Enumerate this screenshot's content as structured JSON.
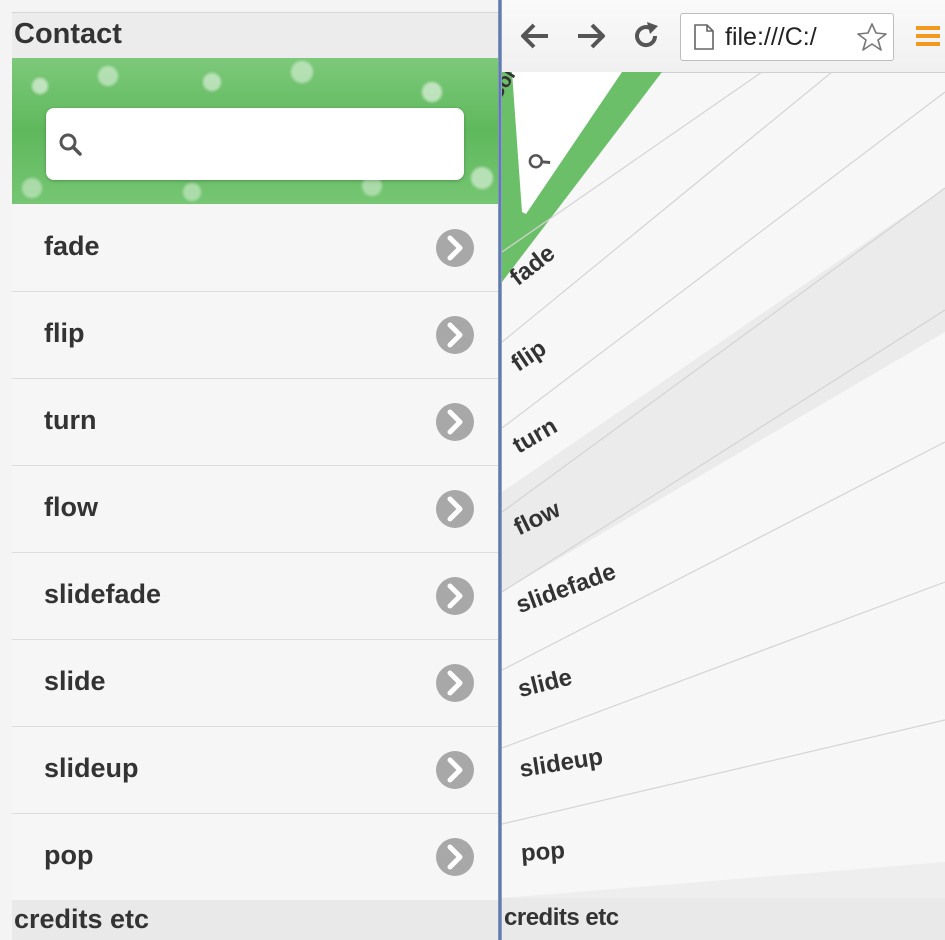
{
  "left": {
    "header_title": "Contact",
    "search": {
      "value": "",
      "placeholder": ""
    },
    "items": [
      {
        "label": "fade"
      },
      {
        "label": "flip"
      },
      {
        "label": "turn"
      },
      {
        "label": "flow"
      },
      {
        "label": "slidefade"
      },
      {
        "label": "slide"
      },
      {
        "label": "slideup"
      },
      {
        "label": "pop"
      }
    ],
    "footer": "credits etc"
  },
  "right": {
    "url": "file:///C:/",
    "header_title": "Cor",
    "items": [
      {
        "label": "fade"
      },
      {
        "label": "flip"
      },
      {
        "label": "turn"
      },
      {
        "label": "flow"
      },
      {
        "label": "slidefade"
      },
      {
        "label": "slide"
      },
      {
        "label": "slideup"
      },
      {
        "label": "pop"
      }
    ],
    "footer": "credits etc"
  },
  "colors": {
    "banner_green": "#5fb85c",
    "chevron_gray": "#a8a8a8",
    "menu_orange": "#f29a1f",
    "divider_blue": "#4d6aa0"
  },
  "icons": {
    "search": "search-icon",
    "chevron": "chevron-right-circle-icon",
    "back": "back-arrow-icon",
    "forward": "forward-arrow-icon",
    "reload": "reload-icon",
    "page": "page-icon",
    "star": "star-icon",
    "menu": "menu-icon"
  }
}
